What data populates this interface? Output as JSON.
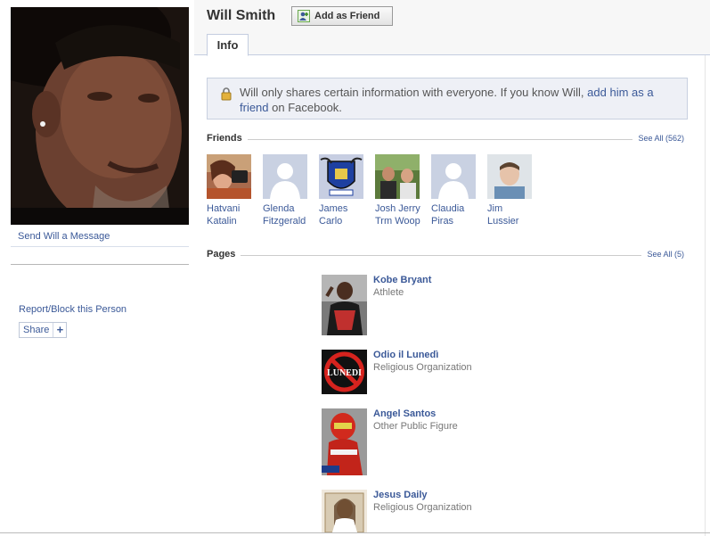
{
  "profile": {
    "name": "Will Smith",
    "add_friend_label": "Add as Friend",
    "send_message": "Send Will a Message",
    "report_block": "Report/Block this Person",
    "share_label": "Share",
    "share_plus": "+"
  },
  "tabs": [
    {
      "label": "Info"
    }
  ],
  "notice": {
    "text_before": "Will only shares certain information with everyone. If you know Will, ",
    "link_text": "add him as a friend",
    "text_after": " on Facebook."
  },
  "friends": {
    "title": "Friends",
    "see_all": "See All (562)",
    "items": [
      {
        "first": "Hatvani",
        "last": "Katalin"
      },
      {
        "first": "Glenda",
        "last": "Fitzgerald"
      },
      {
        "first": "James",
        "last": "Carlo"
      },
      {
        "first": "Josh Jerry",
        "last": "Trm Woop"
      },
      {
        "first": "Claudia",
        "last": "Piras"
      },
      {
        "first": "Jim",
        "last": "Lussier"
      }
    ]
  },
  "pages": {
    "title": "Pages",
    "see_all": "See All (5)",
    "items": [
      {
        "name": "Kobe Bryant",
        "category": "Athlete"
      },
      {
        "name": "Odio il Lunedì",
        "category": "Religious Organization",
        "badge": "LUNEDI"
      },
      {
        "name": "Angel Santos",
        "category": "Other Public Figure"
      },
      {
        "name": "Jesus Daily",
        "category": "Religious Organization"
      }
    ]
  },
  "colors": {
    "link": "#3b5998",
    "border": "#c4cde0",
    "notice_bg": "#eef0f6"
  }
}
